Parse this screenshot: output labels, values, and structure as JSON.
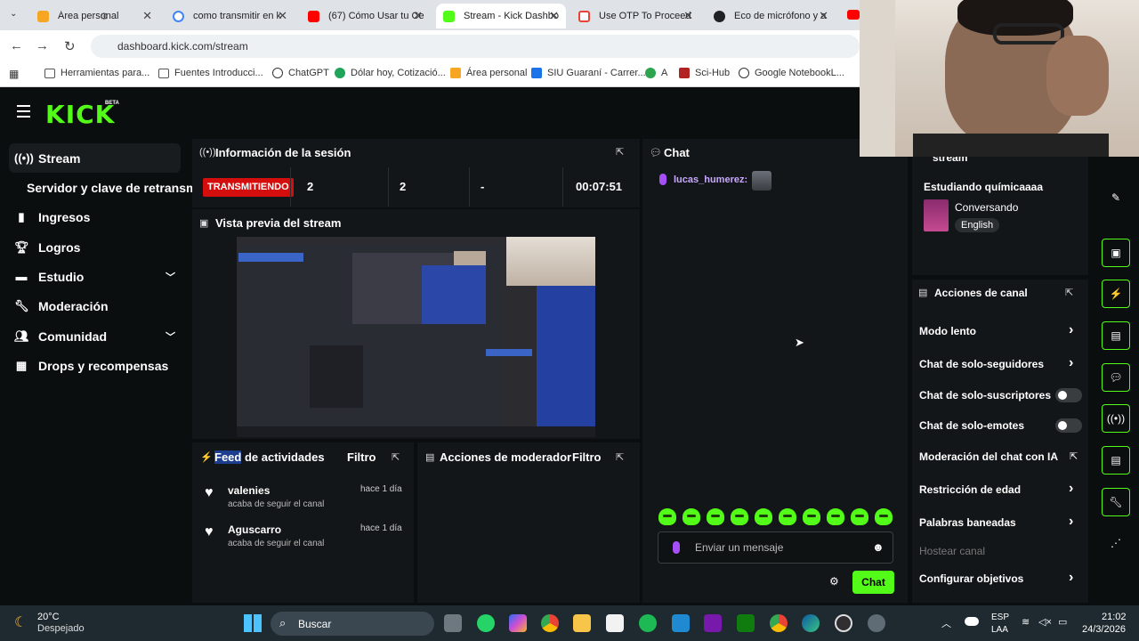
{
  "browser": {
    "tabs": [
      {
        "label": "Área personal",
        "color": "#f6a623"
      },
      {
        "label": "como transmitir en k",
        "color": "#4285f4"
      },
      {
        "label": "(67) Cómo Usar tu Ce",
        "color": "#ff0000"
      },
      {
        "label": "Stream - Kick Dashbo",
        "color": "#53fc18"
      },
      {
        "label": "Use OTP To Proceed",
        "color": "#ea4335"
      },
      {
        "label": "Eco de micrófono y a",
        "color": "#202124"
      }
    ],
    "url": "dashboard.kick.com/stream",
    "bookmarks": [
      "Herramientas para...",
      "Fuentes Introducci...",
      "ChatGPT",
      "Dólar hoy, Cotizació...",
      "Área personal",
      "SIU Guaraní - Carrer...",
      "A",
      "Sci-Hub",
      "Google NotebookL..."
    ]
  },
  "logo": {
    "text": "KICK",
    "badge": "BETA"
  },
  "sidebar": {
    "items": [
      {
        "label": "Stream",
        "icon": "broadcast-icon"
      },
      {
        "label": "Servidor y clave de retransm",
        "icon": ""
      },
      {
        "label": "Ingresos",
        "icon": "bars-icon"
      },
      {
        "label": "Logros",
        "icon": "trophy-icon"
      },
      {
        "label": "Estudio",
        "icon": "studio-icon"
      },
      {
        "label": "Moderación",
        "icon": "wrench-icon"
      },
      {
        "label": "Comunidad",
        "icon": "people-icon"
      },
      {
        "label": "Drops y recompensas",
        "icon": "gift-icon"
      }
    ]
  },
  "session": {
    "title": "Información de la sesión",
    "live": "TRANSMITIENDO",
    "stat1": "2",
    "stat2": "2",
    "stat3": "-",
    "duration": "00:07:51"
  },
  "preview": {
    "title": "Vista previa del stream"
  },
  "feed": {
    "title_highlight": "Feed",
    "title_rest": " de actividades",
    "filter": "Filtro",
    "items": [
      {
        "name": "valenies",
        "sub": "acaba de seguir el canal",
        "time": "hace 1 día"
      },
      {
        "name": "Aguscarro",
        "sub": "acaba de seguir el canal",
        "time": "hace 1 día"
      }
    ]
  },
  "modactions": {
    "title": "Acciones de moderador",
    "filter": "Filtro"
  },
  "chat": {
    "title": "Chat",
    "messages": [
      {
        "user": "lucas_humerez:"
      }
    ],
    "placeholder": "Enviar un mensaje",
    "send": "Chat"
  },
  "stream_info": {
    "header": "stream",
    "title": "Estudiando químicaaaa",
    "category": "Conversando",
    "language": "English"
  },
  "channel_actions": {
    "title": "Acciones de canal",
    "items": [
      {
        "label": "Modo lento",
        "control": "arrow"
      },
      {
        "label": "Chat de solo-seguidores",
        "control": "arrow"
      },
      {
        "label": "Chat de solo-suscriptores",
        "control": "toggle"
      },
      {
        "label": "Chat de solo-emotes",
        "control": "toggle"
      },
      {
        "label": "Moderación del chat con IA",
        "control": "external"
      },
      {
        "label": "Restricción de edad",
        "control": "arrow"
      },
      {
        "label": "Palabras baneadas",
        "control": "arrow"
      },
      {
        "label": "Hostear canal",
        "control": "disabled"
      },
      {
        "label": "Configurar objetivos",
        "control": "arrow"
      }
    ]
  },
  "taskbar": {
    "weather_temp": "20°C",
    "weather_desc": "Despejado",
    "search": "Buscar",
    "lang1": "ESP",
    "lang2": "LAA",
    "time": "21:02",
    "date": "24/3/2026"
  },
  "colors": {
    "accent": "#53fc18",
    "live": "#d40d0d",
    "panel": "#131618"
  }
}
